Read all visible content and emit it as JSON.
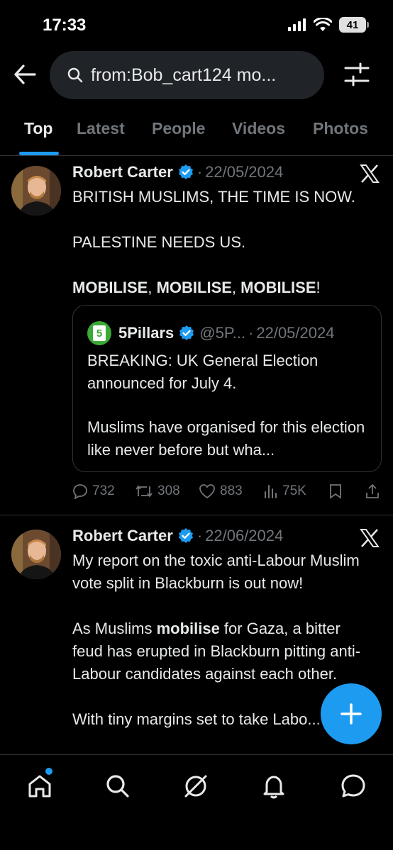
{
  "status_bar": {
    "time": "17:33",
    "battery": "41"
  },
  "search": {
    "query": "from:Bob_cart124 mo..."
  },
  "tabs": [
    {
      "label": "Top",
      "active": true
    },
    {
      "label": "Latest",
      "active": false
    },
    {
      "label": "People",
      "active": false
    },
    {
      "label": "Videos",
      "active": false
    },
    {
      "label": "Photos",
      "active": false
    }
  ],
  "tweets": [
    {
      "name": "Robert Carter",
      "sep": "·",
      "date": "22/05/2024",
      "line1": "BRITISH MUSLIMS, THE TIME IS NOW.",
      "line2": "PALESTINE NEEDS US.",
      "line3_a": "MOBILISE",
      "line3_b": ", ",
      "line3_c": "MOBILISE",
      "line3_d": ", ",
      "line3_e": "MOBILISE",
      "line3_f": "!",
      "quote": {
        "name": "5Pillars",
        "handle": "@5P...",
        "sep": "·",
        "date": "22/05/2024",
        "para1": "BREAKING: UK General Election announced for July 4.",
        "para2": "Muslims have organised for this election like never before but wha..."
      },
      "stats": {
        "replies": "732",
        "reposts": "308",
        "likes": "883",
        "views": "75K"
      }
    },
    {
      "name": "Robert Carter",
      "sep": "·",
      "date": "22/06/2024",
      "para1": "My report on the toxic anti-Labour Muslim vote split in Blackburn is out now!",
      "para2_a": "As Muslims ",
      "para2_b": "mobilise",
      "para2_c": " for Gaza, a bitter feud has erupted in Blackburn pitting anti-Labour candidates against each other.",
      "para3": "With tiny margins set to take Labo..."
    }
  ],
  "colors": {
    "accent": "#1d9bf0",
    "background": "#000000",
    "muted": "#71767b"
  },
  "bottom_nav": [
    "home-icon",
    "search-icon",
    "grok-icon",
    "bell-icon",
    "messages-icon"
  ]
}
